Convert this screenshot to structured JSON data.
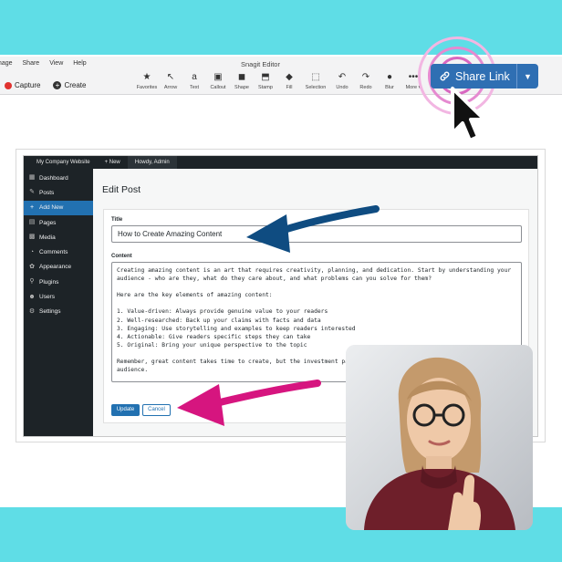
{
  "snagit": {
    "menu": [
      "mage",
      "Share",
      "View",
      "Help"
    ],
    "window_title": "Snagit Editor",
    "capture_label": "Capture",
    "create_label": "Create",
    "tools": [
      {
        "label": "Favorites",
        "icon": "star-icon",
        "glyph": "★"
      },
      {
        "label": "Arrow",
        "icon": "arrow-tool-icon",
        "glyph": "↖"
      },
      {
        "label": "Text",
        "icon": "text-tool-icon",
        "glyph": "a"
      },
      {
        "label": "Callout",
        "icon": "callout-icon",
        "glyph": "▣"
      },
      {
        "label": "Shape",
        "icon": "shape-icon",
        "glyph": "◼"
      },
      {
        "label": "Stamp",
        "icon": "stamp-icon",
        "glyph": "⬒"
      },
      {
        "label": "Fill",
        "icon": "fill-icon",
        "glyph": "◆"
      },
      {
        "label": "Selection",
        "icon": "selection-icon",
        "glyph": "⬚"
      },
      {
        "label": "Undo",
        "icon": "undo-icon",
        "glyph": "↶"
      },
      {
        "label": "Redo",
        "icon": "redo-icon",
        "glyph": "↷"
      },
      {
        "label": "Blur",
        "icon": "blur-icon",
        "glyph": "●"
      },
      {
        "label": "More ▾",
        "icon": "more-icon",
        "glyph": "•••"
      }
    ],
    "share_link_label": "Share Link",
    "share_color": "#2f6fb3"
  },
  "wp": {
    "topbar": {
      "site": "My Company Website",
      "new": "+ New",
      "howdy": "Howdy, Admin"
    },
    "sidebar": [
      {
        "label": "Dashboard",
        "icon": "dashboard-icon",
        "glyph": "▦"
      },
      {
        "label": "Posts",
        "icon": "posts-icon",
        "glyph": "✎"
      },
      {
        "label": "Add New",
        "icon": "add-new-icon",
        "glyph": "+",
        "active": true
      },
      {
        "label": "Pages",
        "icon": "pages-icon",
        "glyph": "▤"
      },
      {
        "label": "Media",
        "icon": "media-icon",
        "glyph": "▩"
      },
      {
        "label": "Comments",
        "icon": "comments-icon",
        "glyph": "◔"
      },
      {
        "label": "Appearance",
        "icon": "appearance-icon",
        "glyph": "✿"
      },
      {
        "label": "Plugins",
        "icon": "plugins-icon",
        "glyph": "⚲"
      },
      {
        "label": "Users",
        "icon": "users-icon",
        "glyph": "☻"
      },
      {
        "label": "Settings",
        "icon": "settings-icon",
        "glyph": "⚙"
      }
    ],
    "edit_heading": "Edit Post",
    "title_label": "Title",
    "title_value": "How to Create Amazing Content",
    "content_label": "Content",
    "content_value": "Creating amazing content is an art that requires creativity, planning, and dedication. Start by understanding your audience - who are they, what do they care about, and what problems can you solve for them?\n\nHere are the key elements of amazing content:\n\n1. Value-driven: Always provide genuine value to your readers\n2. Well-researched: Back up your claims with facts and data\n3. Engaging: Use storytelling and examples to keep readers interested\n4. Actionable: Give readers specific steps they can take\n5. Original: Bring your unique perspective to the topic\n\nRemember, great content takes time to create, but the investment pays off when it truly connects with your audience.",
    "update_label": "Update",
    "cancel_label": "Cancel"
  },
  "colors": {
    "background": "#5fdde6",
    "arrow_blue": "#0f4c81",
    "arrow_pink": "#d6157f",
    "wp_admin_dark": "#1d2327",
    "wp_blue": "#2271b1"
  }
}
